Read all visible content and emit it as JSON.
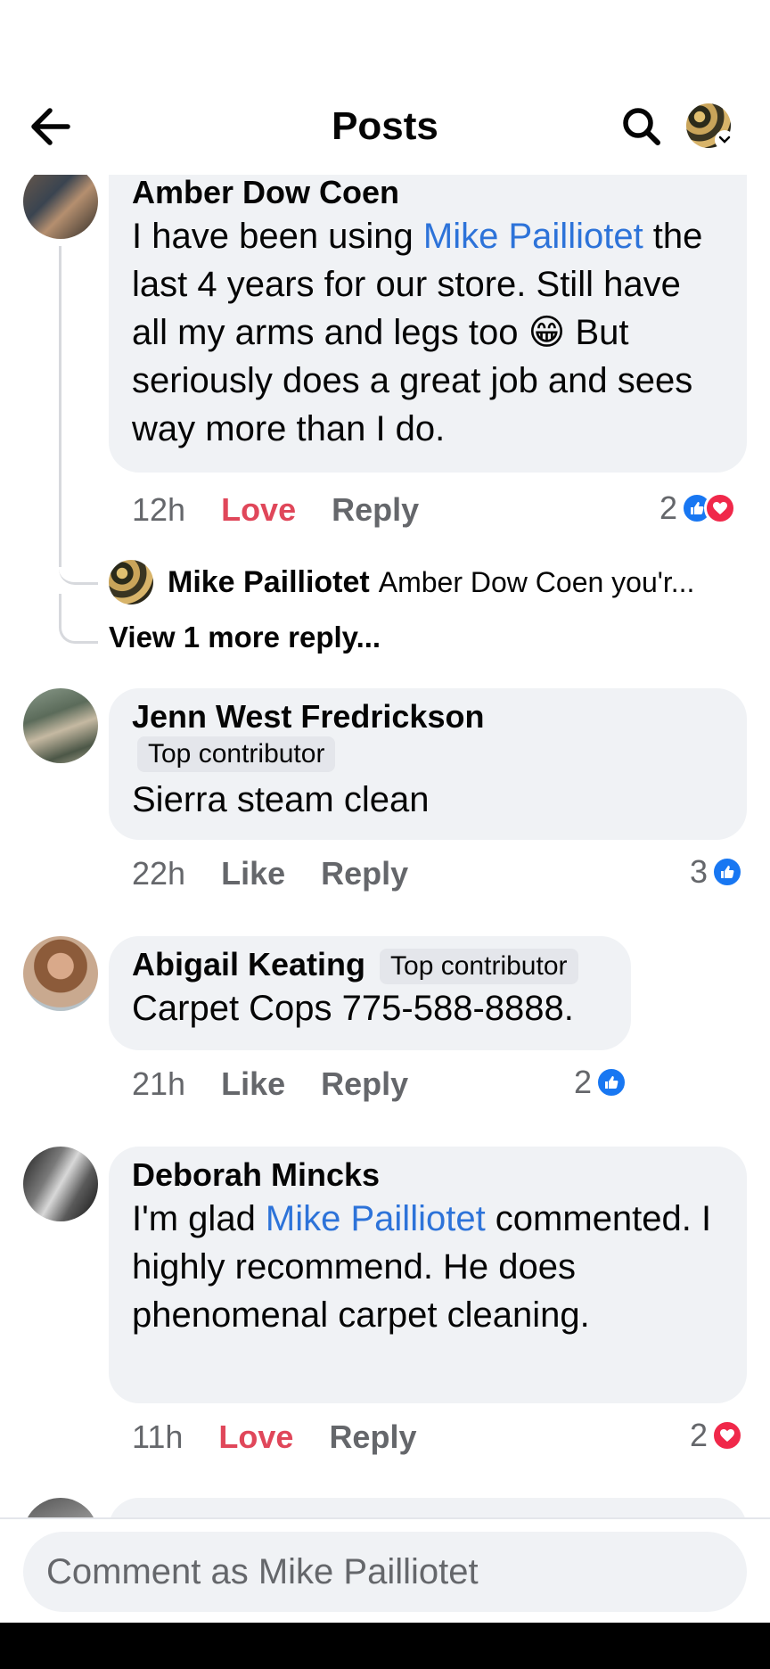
{
  "header": {
    "title": "Posts",
    "back_icon": "arrow-left-icon",
    "search_icon": "search-icon"
  },
  "comments": [
    {
      "author": "Amber Dow Coen",
      "text_parts": [
        "I have been using ",
        "Mike Pailliotet",
        " the last 4 years for our store.  Still have all my arms and legs too 😁 But seriously does a great job and sees way more than I do."
      ],
      "time": "12h",
      "react_label": "Love",
      "reply_label": "Reply",
      "reaction_count": "2",
      "reactions": [
        "like",
        "love"
      ],
      "replies": [
        {
          "author": "Mike Pailliotet",
          "text": "Amber Dow Coen you'r..."
        }
      ],
      "view_more": "View 1 more reply..."
    },
    {
      "author": "Jenn West Fredrickson",
      "badge": "Top contributor",
      "text": "Sierra steam clean",
      "time": "22h",
      "react_label": "Like",
      "reply_label": "Reply",
      "reaction_count": "3",
      "reactions": [
        "like"
      ]
    },
    {
      "author": "Abigail Keating",
      "badge": "Top contributor",
      "text": "Carpet Cops 775-588-8888.",
      "time": "21h",
      "react_label": "Like",
      "reply_label": "Reply",
      "reaction_count": "2",
      "reactions": [
        "like"
      ]
    },
    {
      "author": "Deborah Mincks",
      "text_parts": [
        "I'm glad ",
        "Mike Pailliotet",
        " commented. I highly recommend. He does phenomenal carpet cleaning."
      ],
      "time": "11h",
      "react_label": "Love",
      "reply_label": "Reply",
      "reaction_count": "2",
      "reactions": [
        "love"
      ]
    }
  ],
  "composer": {
    "placeholder": "Comment as Mike Pailliotet"
  },
  "colors": {
    "link": "#2d73d9",
    "love": "#e0475a",
    "like_reaction": "#1877f2",
    "love_reaction": "#f0284a",
    "bubble": "#f0f2f5",
    "meta": "#65676b"
  }
}
